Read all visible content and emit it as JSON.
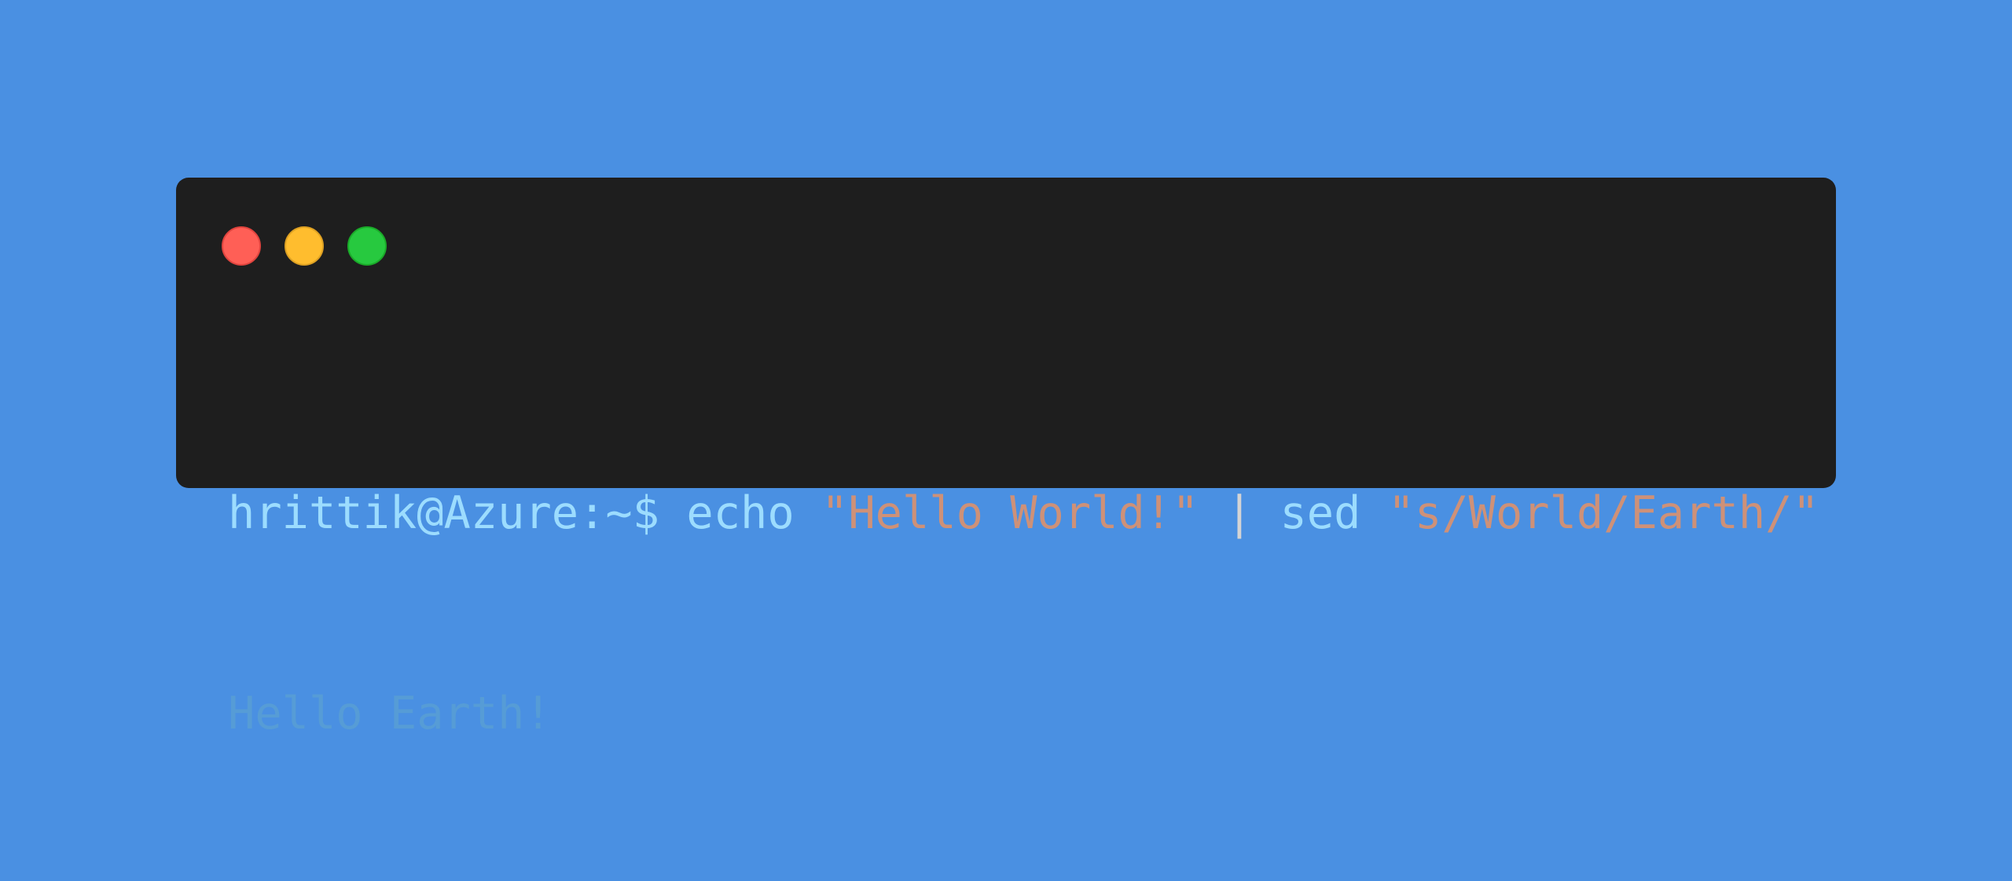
{
  "colors": {
    "background": "#4a90e2",
    "terminal_bg": "#1e1e1e",
    "close": "#ff5f56",
    "minimize": "#ffbd2e",
    "maximize": "#27c93f",
    "prompt": "#9cdcfe",
    "string": "#ce9178",
    "output": "#569cd6"
  },
  "window_controls": [
    "close",
    "minimize",
    "maximize"
  ],
  "terminal": {
    "command_line": {
      "prompt": "hrittik@Azure:~$",
      "cmd1": "echo",
      "arg1": "\"Hello World!\"",
      "pipe": "|",
      "cmd2": "sed",
      "arg2": "\"s/World/Earth/\""
    },
    "output": "Hello Earth!"
  }
}
